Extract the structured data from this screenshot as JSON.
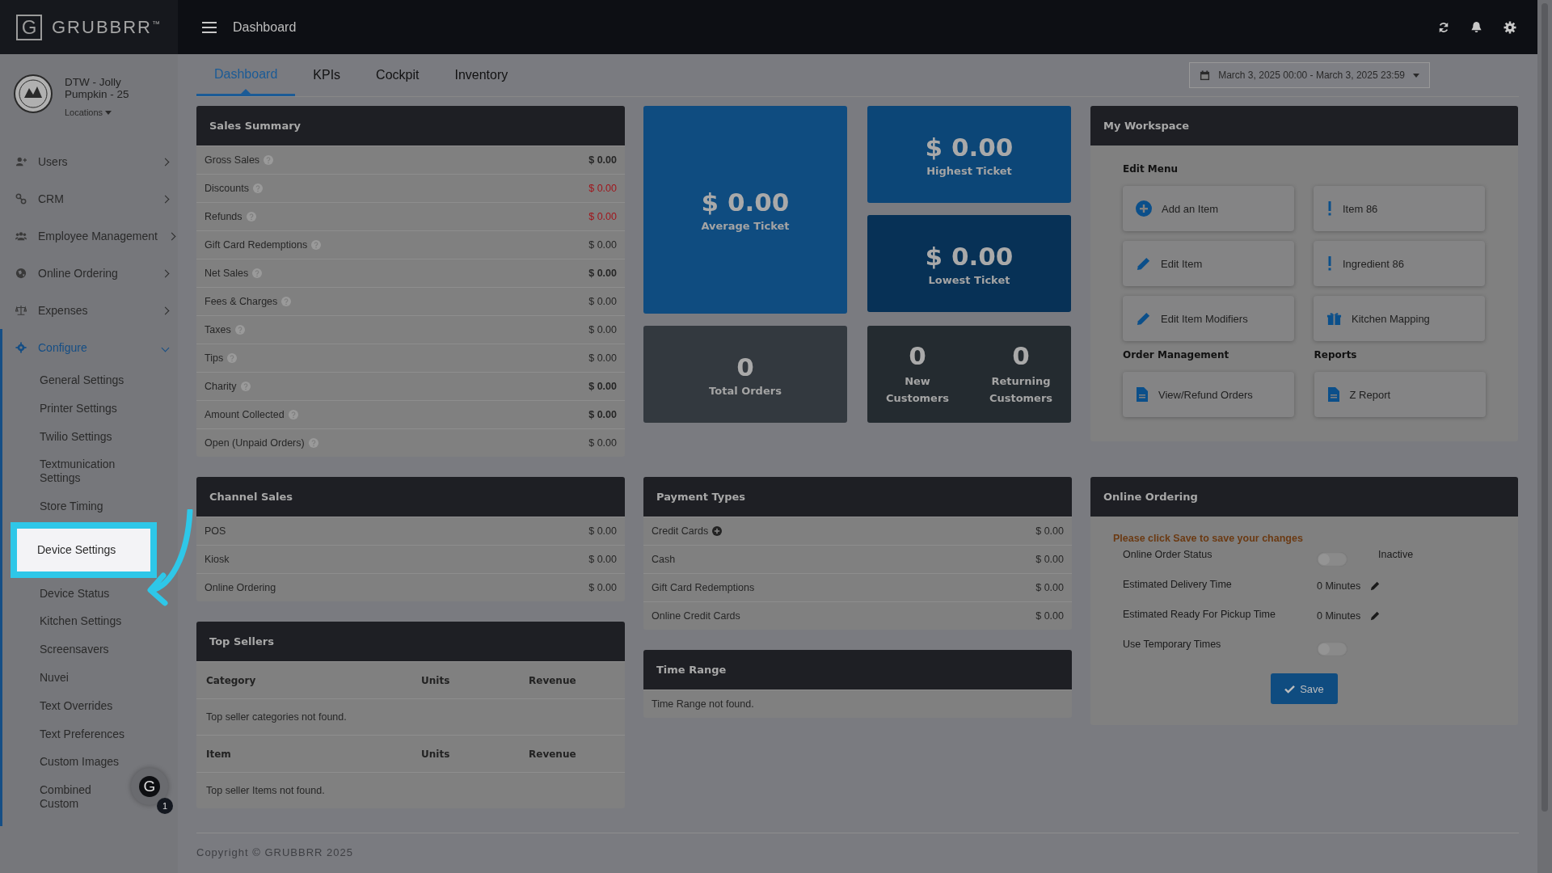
{
  "brand": {
    "logo_letter": "G",
    "name": "GRUBBRR",
    "mark": "™"
  },
  "topbar": {
    "title": "Dashboard"
  },
  "store": {
    "name": "DTW - Jolly Pumpkin - 25",
    "locations": "Locations"
  },
  "sidebar": {
    "items": [
      {
        "label": "Users",
        "expanded": false
      },
      {
        "label": "CRM",
        "expanded": false
      },
      {
        "label": "Employee Management",
        "expanded": false
      },
      {
        "label": "Online Ordering",
        "expanded": false
      },
      {
        "label": "Expenses",
        "expanded": false
      },
      {
        "label": "Configure",
        "expanded": true,
        "children": [
          {
            "label": "General Settings",
            "selected": false
          },
          {
            "label": "Printer Settings",
            "selected": false
          },
          {
            "label": "Twilio Settings",
            "selected": false
          },
          {
            "label": "Textmunication Settings",
            "selected": false
          },
          {
            "label": "Store Timing",
            "selected": false
          },
          {
            "label": "Device Settings",
            "selected": true
          },
          {
            "label": "Device Status",
            "selected": false
          },
          {
            "label": "Kitchen Settings",
            "selected": false
          },
          {
            "label": "Screensavers",
            "selected": false
          },
          {
            "label": "Nuvei",
            "selected": false
          },
          {
            "label": "Text Overrides",
            "selected": false
          },
          {
            "label": "Text Preferences",
            "selected": false
          },
          {
            "label": "Custom Images",
            "selected": false
          },
          {
            "label": "Combined Custom",
            "selected": false
          }
        ]
      }
    ]
  },
  "chat": {
    "letter": "G",
    "badge": "1"
  },
  "tabs": [
    {
      "label": "Dashboard",
      "selected": true
    },
    {
      "label": "KPIs",
      "selected": false
    },
    {
      "label": "Cockpit",
      "selected": false
    },
    {
      "label": "Inventory",
      "selected": false
    }
  ],
  "date_range": "March 3, 2025 00:00 - March 3, 2025 23:59",
  "sales_summary": {
    "title": "Sales Summary",
    "rows": [
      {
        "label": "Gross Sales",
        "value": "$ 0.00",
        "bold": true,
        "negative": false
      },
      {
        "label": "Discounts",
        "value": "$ 0.00",
        "bold": false,
        "negative": true
      },
      {
        "label": "Refunds",
        "value": "$ 0.00",
        "bold": false,
        "negative": true
      },
      {
        "label": "Gift Card Redemptions",
        "value": "$ 0.00",
        "bold": false,
        "negative": false
      },
      {
        "label": "Net Sales",
        "value": "$ 0.00",
        "bold": true,
        "negative": false
      },
      {
        "label": "Fees & Charges",
        "value": "$ 0.00",
        "bold": false,
        "negative": false
      },
      {
        "label": "Taxes",
        "value": "$ 0.00",
        "bold": false,
        "negative": false
      },
      {
        "label": "Tips",
        "value": "$ 0.00",
        "bold": false,
        "negative": false
      },
      {
        "label": "Charity",
        "value": "$ 0.00",
        "bold": true,
        "negative": false
      },
      {
        "label": "Amount Collected",
        "value": "$ 0.00",
        "bold": true,
        "negative": false
      },
      {
        "label": "Open (Unpaid Orders)",
        "value": "$ 0.00",
        "bold": false,
        "negative": false
      }
    ]
  },
  "tickets": {
    "average": {
      "value": "$ 0.00",
      "label": "Average Ticket"
    },
    "highest": {
      "value": "$ 0.00",
      "label": "Highest Ticket"
    },
    "lowest": {
      "value": "$ 0.00",
      "label": "Lowest Ticket"
    }
  },
  "total_orders": {
    "value": "0",
    "label": "Total Orders"
  },
  "customers": [
    {
      "value": "0",
      "label": "New Customers"
    },
    {
      "value": "0",
      "label": "Returning Customers"
    }
  ],
  "workspace": {
    "title": "My Workspace",
    "sections": [
      {
        "title": "Edit Menu",
        "actions": [
          {
            "label": "Add an Item",
            "kind": "add"
          },
          {
            "label": "Item 86",
            "kind": "alert"
          },
          {
            "label": "Edit Item",
            "kind": "edit"
          },
          {
            "label": "Ingredient 86",
            "kind": "alert"
          },
          {
            "label": "Edit Item Modifiers",
            "kind": "edit"
          },
          {
            "label": "Kitchen Mapping",
            "kind": "mapping"
          }
        ]
      },
      {
        "title": "Order Management",
        "actions": [
          {
            "label": "View/Refund Orders",
            "kind": "document"
          }
        ]
      },
      {
        "title": "Reports",
        "actions": [
          {
            "label": "Z Report",
            "kind": "document"
          }
        ]
      }
    ]
  },
  "channel_sales": {
    "title": "Channel Sales",
    "rows": [
      {
        "label": "POS",
        "value": "$ 0.00"
      },
      {
        "label": "Kiosk",
        "value": "$ 0.00"
      },
      {
        "label": "Online Ordering",
        "value": "$ 0.00"
      }
    ]
  },
  "payment_types": {
    "title": "Payment Types",
    "rows": [
      {
        "label": "Credit Cards",
        "value": "$ 0.00",
        "expandable": true
      },
      {
        "label": "Cash",
        "value": "$ 0.00",
        "expandable": false
      },
      {
        "label": "Gift Card Redemptions",
        "value": "$ 0.00",
        "expandable": false
      },
      {
        "label": "Online Credit Cards",
        "value": "$ 0.00",
        "expandable": false
      }
    ]
  },
  "top_sellers": {
    "title": "Top Sellers",
    "tables": [
      {
        "columns": [
          "Category",
          "Units",
          "Revenue"
        ],
        "empty": "Top seller categories not found."
      },
      {
        "columns": [
          "Item",
          "Units",
          "Revenue"
        ],
        "empty": "Top seller Items not found."
      }
    ]
  },
  "time_range": {
    "title": "Time Range",
    "empty": "Time Range not found."
  },
  "online_ordering": {
    "title": "Online Ordering",
    "notice": "Please click Save to save your changes",
    "rows": [
      {
        "kind": "toggle",
        "label": "Online Order Status",
        "on": false,
        "state": "Inactive"
      },
      {
        "kind": "time",
        "label": "Estimated Delivery Time",
        "value": "0 Minutes"
      },
      {
        "kind": "time",
        "label": "Estimated Ready For Pickup Time",
        "value": "0 Minutes"
      },
      {
        "kind": "toggle",
        "label": "Use Temporary Times",
        "on": false
      }
    ],
    "save": "Save"
  },
  "footer": "Copyright © GRUBBRR 2025"
}
